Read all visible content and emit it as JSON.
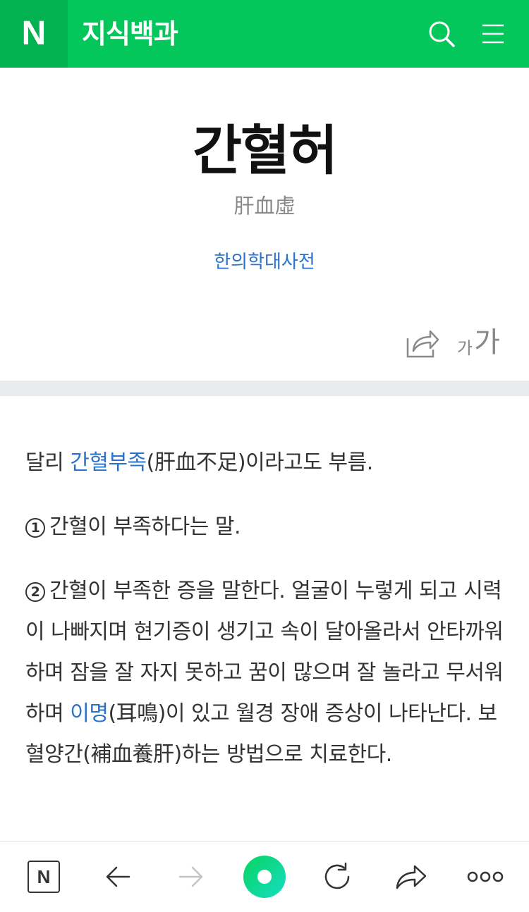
{
  "header": {
    "logo_letter": "N",
    "brand": "지식백과",
    "icons": [
      "search-icon",
      "menu-icon"
    ],
    "accent_color": "#03c75a"
  },
  "article": {
    "title": "간혈허",
    "hanja": "肝血虛",
    "source": "한의학대사전",
    "font_small": "가",
    "font_large": "가"
  },
  "body": {
    "p1_pre": "달리 ",
    "p1_link": "간혈부족",
    "p1_post": "(肝血不足)이라고도 부름.",
    "p2_num": "1",
    "p2_text": "간혈이 부족하다는 말.",
    "p3_num": "2",
    "p3_pre": "간혈이 부족한 증을 말한다. 얼굴이 누렇게 되고 시력이 나빠지며 현기증이 생기고 속이 달아올라서 안타까워하며 잠을 잘 자지 못하고 꿈이 많으며 잘 놀라고 무서워하며 ",
    "p3_link": "이명",
    "p3_post": "(耳鳴)이 있고 월경 장애 증상이 나타난다. 보혈양간(補血養肝)하는 방법으로 치료한다.",
    "link_color": "#2a73cc"
  },
  "bottom_nav": {
    "logo_letter": "N",
    "icons": [
      "naver-home-icon",
      "back-arrow-icon",
      "forward-arrow-icon",
      "green-dot-icon",
      "reload-icon",
      "share-icon",
      "more-icon"
    ]
  }
}
